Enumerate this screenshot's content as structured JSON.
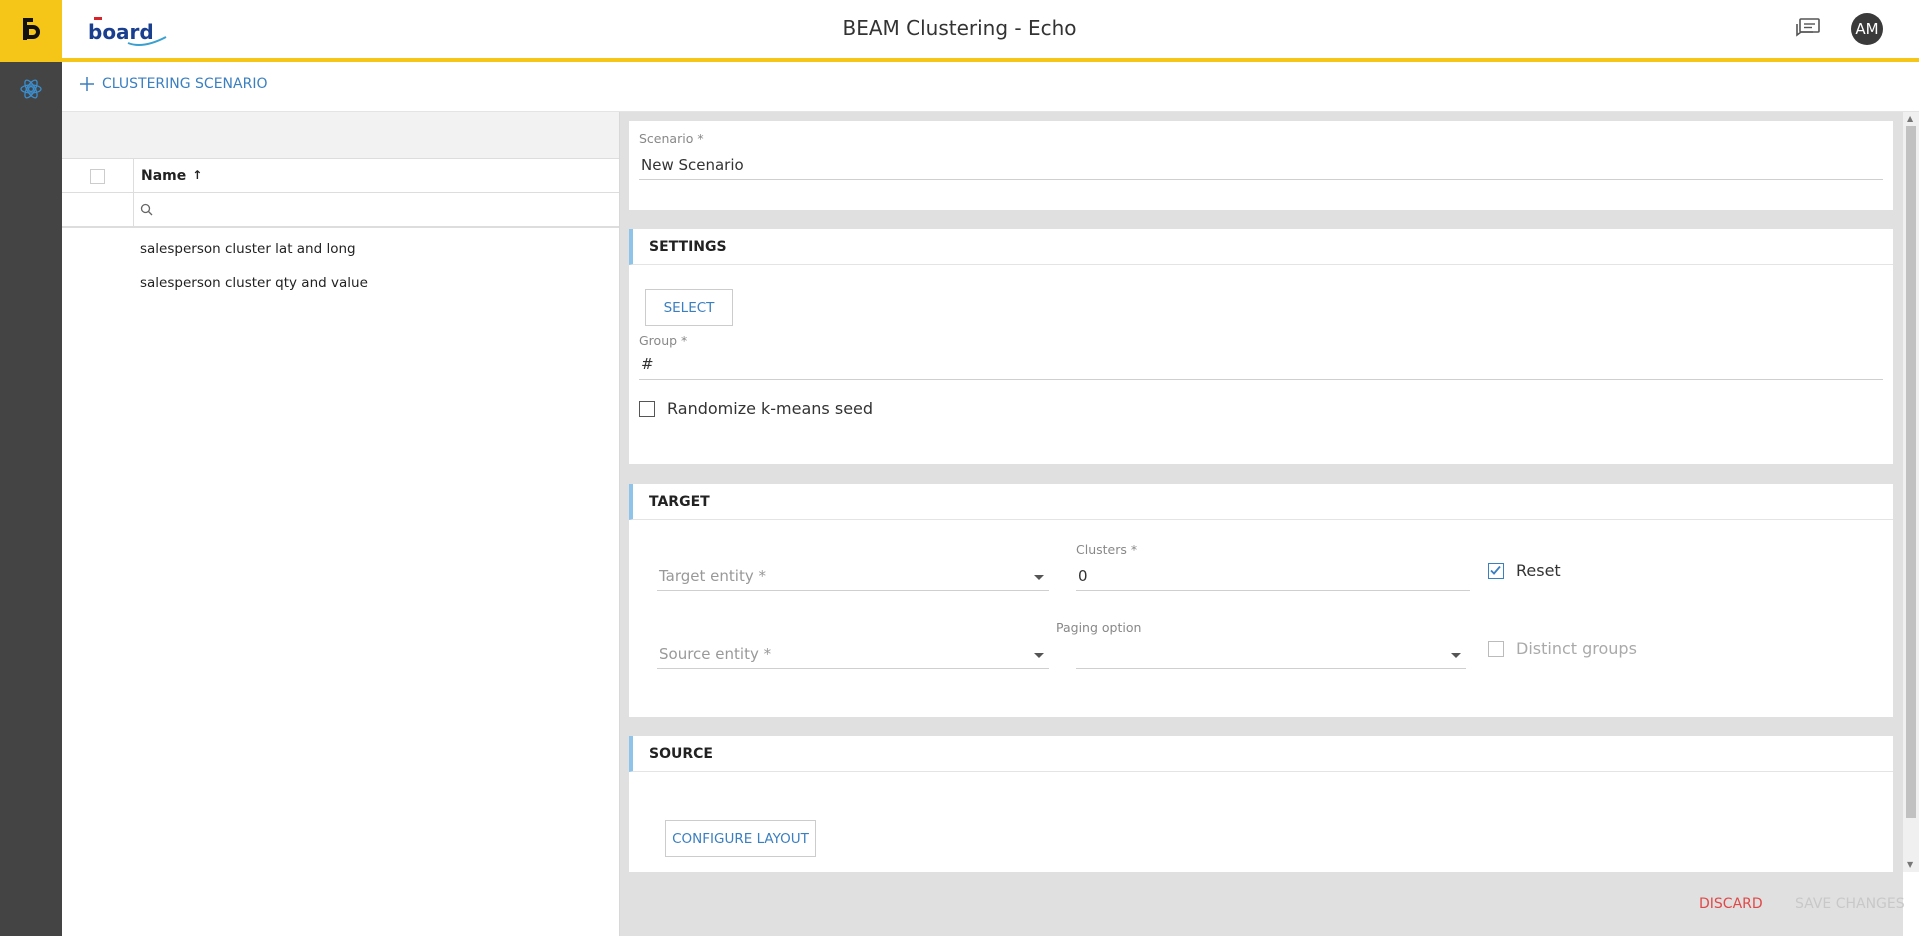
{
  "header": {
    "brand_logo_text": "board",
    "title": "BEAM Clustering - Echo",
    "avatar_initials": "AM"
  },
  "toolbar": {
    "add_scenario_label": "CLUSTERING SCENARIO"
  },
  "list": {
    "column_name": "Name",
    "sort_indicator": "↑",
    "items": [
      "salesperson cluster lat and long",
      "salesperson cluster qty and value"
    ]
  },
  "scenario": {
    "label": "Scenario *",
    "value": "New Scenario"
  },
  "settings": {
    "title": "SETTINGS",
    "select_label": "SELECT",
    "group_label": "Group *",
    "group_value": "#",
    "randomize_label": "Randomize k-means seed",
    "randomize_checked": false
  },
  "target": {
    "title": "TARGET",
    "target_entity_placeholder": "Target entity *",
    "clusters_label": "Clusters *",
    "clusters_value": "0",
    "reset_label": "Reset",
    "reset_checked": true,
    "source_entity_placeholder": "Source entity *",
    "paging_label": "Paging option",
    "paging_value": "",
    "distinct_label": "Distinct groups",
    "distinct_checked": false
  },
  "source": {
    "title": "SOURCE",
    "configure_label": "CONFIGURE LAYOUT"
  },
  "footer": {
    "discard_label": "DISCARD",
    "save_label": "SAVE CHANGES"
  },
  "colors": {
    "accent_yellow": "#f5c518",
    "link_blue": "#3a7fc0",
    "discard_red": "#e04848",
    "rail_dark": "#444444"
  }
}
